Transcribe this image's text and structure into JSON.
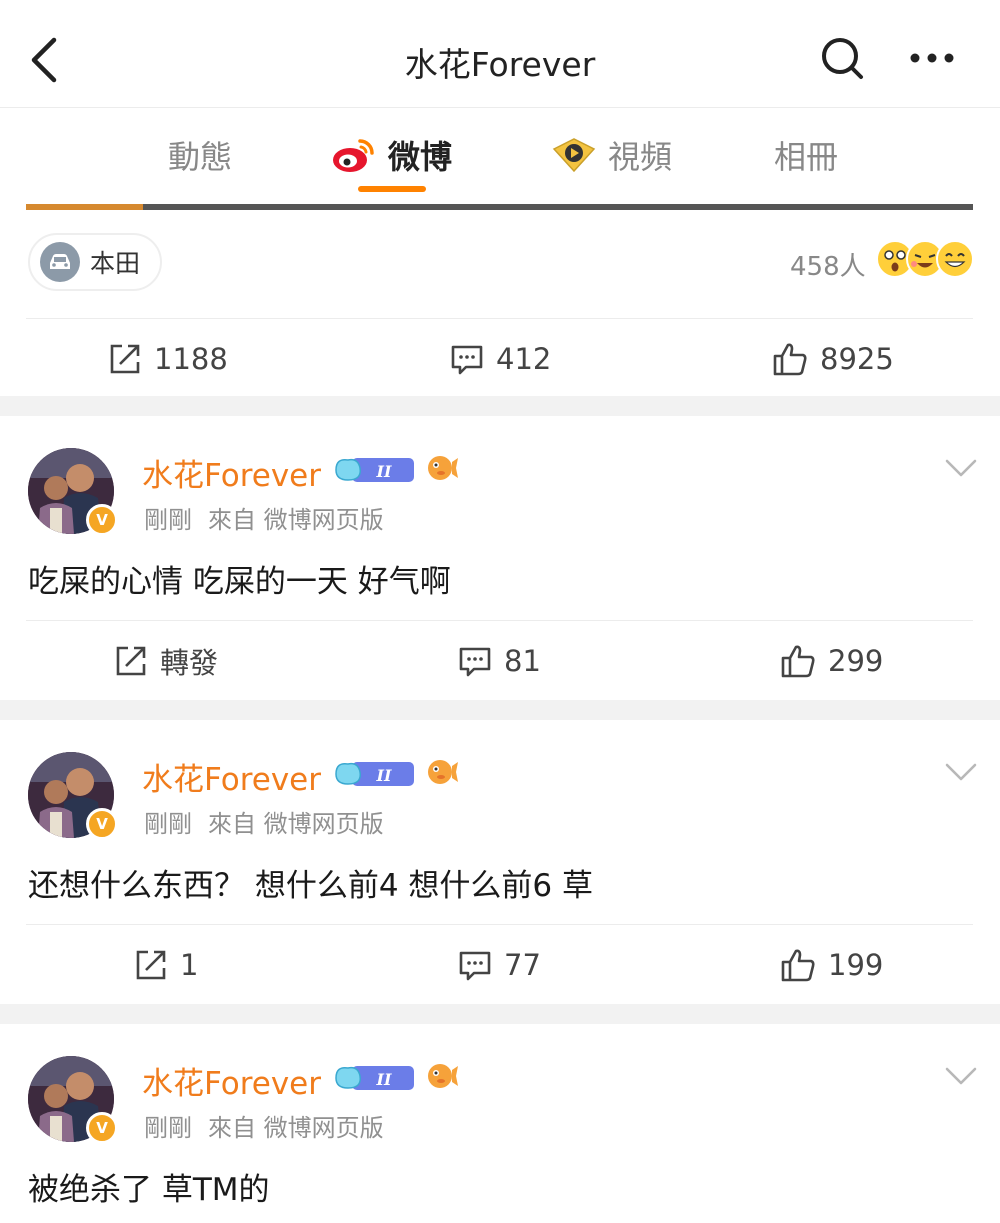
{
  "header": {
    "title": "水花Forever",
    "back_icon": "chevron-left-icon",
    "search_icon": "search-icon",
    "more_icon": "more-dots-icon"
  },
  "tabs": [
    {
      "label": "動態",
      "active": false
    },
    {
      "label": "微博",
      "active": true,
      "icon": "weibo-logo-icon"
    },
    {
      "label": "視頻",
      "active": false,
      "icon": "video-badge-icon"
    },
    {
      "label": "相冊",
      "active": false
    }
  ],
  "colors": {
    "accent": "#ff8200",
    "username": "#f07c1c",
    "muted": "#909090",
    "divider_band": "#f2f2f2"
  },
  "first_card": {
    "topic_label": "本田",
    "reactions_count": "458人",
    "actions": {
      "repost": "1188",
      "comments": "412",
      "likes": "8925"
    }
  },
  "posts": [
    {
      "username": "水花Forever",
      "meta_time": "剛剛",
      "meta_source": "來自 微博网页版",
      "text": "吃屎的心情 吃屎的一天 好气啊",
      "actions": {
        "repost": "轉發",
        "comments": "81",
        "likes": "299"
      }
    },
    {
      "username": "水花Forever",
      "meta_time": "剛剛",
      "meta_source": "來自 微博网页版",
      "text": "还想什么东西？ 想什么前4 想什么前6 草",
      "actions": {
        "repost": "1",
        "comments": "77",
        "likes": "199"
      }
    },
    {
      "username": "水花Forever",
      "meta_time": "剛剛",
      "meta_source": "來自 微博网页版",
      "text": "被绝杀了 草TM的"
    }
  ]
}
